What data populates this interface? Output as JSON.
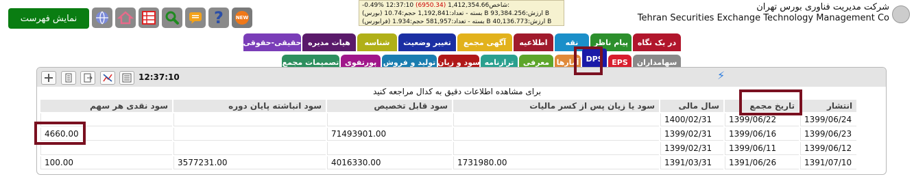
{
  "top_bar": {
    "show_list_label": "نمایش فهرست",
    "icons": [
      "new-icon",
      "help-icon",
      "message-icon",
      "search-icon",
      "table-icon",
      "home-icon",
      "globe-icon"
    ],
    "new_badge": "NEW",
    "help_glyph": "?"
  },
  "market": {
    "line1_pre": "شاخص:",
    "line1_val": "1,412,354.66",
    "line1_change": "(6950.34)",
    "line1_post": "-0.49% 12:37:10",
    "line2": "(بورس) بسته - تعداد:1,192,841 حجم:10.74 B ارزش:93,384.256 B",
    "line3": "(فرابورس) بسته - تعداد:581,957 حجم:1.934 B ارزش:40,136.773 B"
  },
  "company": {
    "name_fa": "شرکت مدیریت فناوری بورس تهران",
    "name_en": "Tehran Securities Exchange Technology Management Co"
  },
  "tabs_row1": [
    {
      "label": "در یک نگاه",
      "color": "#b1162c"
    },
    {
      "label": "پیام ناظر",
      "color": "#2c8f2c"
    },
    {
      "label": "نقه",
      "color": "#1b8fc9"
    },
    {
      "label": "اطلاعیه",
      "color": "#a01a2c"
    },
    {
      "label": "آگهی مجمع",
      "color": "#e2b21c"
    },
    {
      "label": "تغییر وضعیت",
      "color": "#1b2fa3"
    },
    {
      "label": "شناسه",
      "color": "#b0b018"
    },
    {
      "label": "هیات مدیره",
      "color": "#5a1a6a"
    },
    {
      "label": "حقیقی-حقوقی",
      "color": "#7a3db8"
    }
  ],
  "tabs_row2": [
    {
      "label": "سهامداران",
      "color": "#8a8a8a"
    },
    {
      "label": "EPS",
      "color": "#d81e2e"
    },
    {
      "label": "DPS",
      "color": "#1a1aa8"
    },
    {
      "label": "آمارها",
      "color": "#e08a3a"
    },
    {
      "label": "معرفی",
      "color": "#5da52a"
    },
    {
      "label": "ترازنامه",
      "color": "#2aa08f"
    },
    {
      "label": "سود و زیان",
      "color": "#b01818"
    },
    {
      "label": "تولید و فروش",
      "color": "#1a7db0"
    },
    {
      "label": "پورتفوی",
      "color": "#a0168a"
    },
    {
      "label": "تصمیمات مجمع",
      "color": "#2e8f5f"
    }
  ],
  "panel": {
    "time": "12:37:10",
    "notice": "برای مشاهده اطلاعات دقیق به کدال مراجعه کنید",
    "columns": [
      "انتشار",
      "تاریخ مجمع",
      "سال مالی",
      "سود یا زیان پس از کسر مالیات",
      "سود قابل تخصیص",
      "سود انباشته پایان دوره",
      "سود نقدی هر سهم"
    ],
    "rows": [
      [
        "1399/06/24",
        "1399/06/22",
        "1400/02/31",
        "",
        "",
        "",
        ""
      ],
      [
        "1399/06/23",
        "1399/06/16",
        "1399/02/31",
        "",
        "71493901.00",
        "",
        "4660.00"
      ],
      [
        "1399/06/12",
        "1399/06/11",
        "1399/02/31",
        "",
        "",
        "",
        ""
      ],
      [
        "1391/07/10",
        "1391/06/26",
        "1391/03/31",
        "1731980.00",
        "4016330.00",
        "3577231.00",
        "100.00"
      ]
    ]
  }
}
